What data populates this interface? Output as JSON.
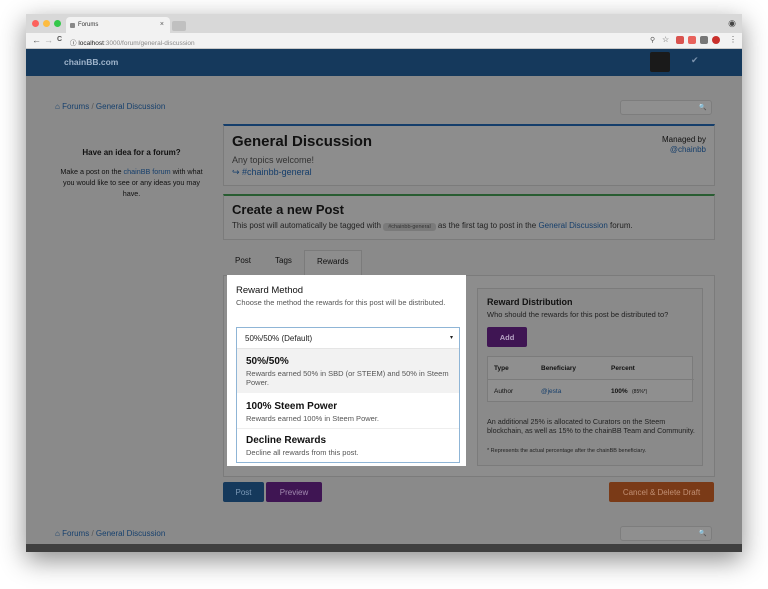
{
  "browser": {
    "tab_title": "Forums",
    "tab_close": "×",
    "url_host": "localhost",
    "url_path": ":3000/forum/general-discussion",
    "back": "←",
    "forward": "→",
    "reload": "C",
    "info": "ⓘ",
    "menu": "⋮",
    "colors": {
      "close": "#fc615d",
      "minimize": "#fdbc40",
      "maximize": "#34c84a"
    }
  },
  "header": {
    "brand": "chainBB.com",
    "check_icon": "✔"
  },
  "breadcrumb": {
    "home_icon": "⌂",
    "forums": "Forums",
    "sep": "/",
    "current": "General Discussion"
  },
  "search": {
    "icon": "🔍"
  },
  "sidebar": {
    "heading": "Have an idea for a forum?",
    "text_before": "Make a post on the ",
    "link": "chainBB forum",
    "text_after": " with what you would like to see or any ideas you may have."
  },
  "forum": {
    "title": "General Discussion",
    "subtitle": "Any topics welcome!",
    "tag_link": "↪ #chainbb-general",
    "managed_label": "Managed by",
    "managed_user": "@chainbb"
  },
  "create": {
    "title": "Create a new Post",
    "line_before": "This post will automatically be tagged with ",
    "pill": "#chainbb-general",
    "line_mid": " as the first tag to post in the ",
    "link": "General Discussion",
    "line_after": " forum."
  },
  "tabs": {
    "post": "Post",
    "tags": "Tags",
    "rewards": "Rewards"
  },
  "reward_method": {
    "title": "Reward Method",
    "description": "Choose the method the rewards for this post will be distributed.",
    "selected": "50%/50% (Default)",
    "caret": "▾",
    "options": [
      {
        "title": "50%/50%",
        "desc": "Rewards earned 50% in SBD (or STEEM) and 50% in Steem Power."
      },
      {
        "title": "100% Steem Power",
        "desc": "Rewards earned 100% in Steem Power."
      },
      {
        "title": "Decline Rewards",
        "desc": "Decline all rewards from this post."
      }
    ]
  },
  "reward_distribution": {
    "title": "Reward Distribution",
    "subtitle": "Who should the rewards for this post be distributed to?",
    "add": "Add",
    "columns": [
      "Type",
      "Beneficiary",
      "Percent"
    ],
    "row": {
      "type": "Author",
      "beneficiary": "@jesta",
      "percent": "100%",
      "actual": "(85%*)"
    },
    "note": "An additional 25% is allocated to Curators on the Steem blockchain, as well as 15% to the chainBB Team and Community.",
    "footnote": "* Represents the actual percentage after the chainBB beneficiary."
  },
  "actions": {
    "post": "Post",
    "preview": "Preview",
    "cancel": "Cancel & Delete Draft"
  }
}
